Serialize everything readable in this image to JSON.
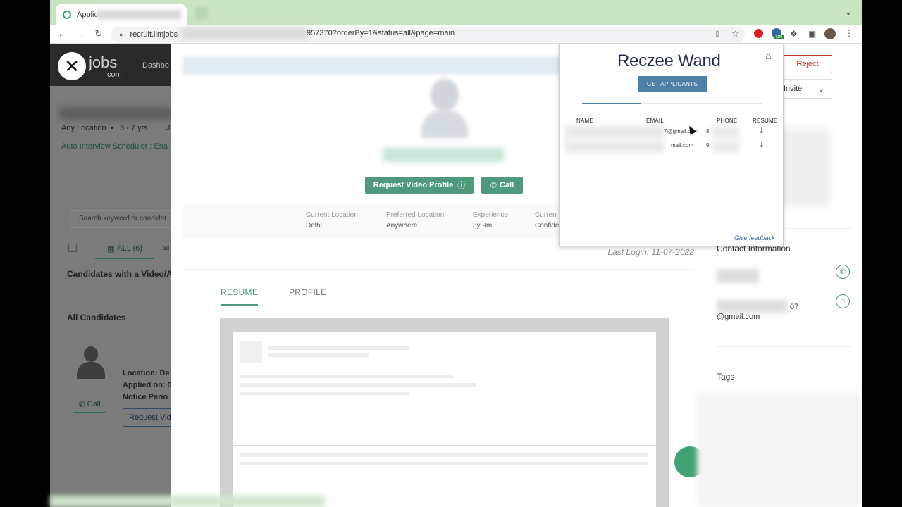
{
  "browser": {
    "tab_title": "Applic",
    "url_host": "recruit.iimjobs",
    "url_tail": "957370?orderBy=1&status=all&page=main",
    "extension_badge": "ON"
  },
  "site": {
    "logo": "jobs",
    "logo_sub": ".com",
    "nav_dashboard": "Dashbo"
  },
  "left_pane": {
    "location": "Any Location",
    "experience": "3 - 7 yrs",
    "experience_extra": "J",
    "auto_interview": "Auto Interview Scheduler : Ena",
    "search_placeholder": "Search keyword or candidat",
    "tab_all": "ALL (6)",
    "section_video": "Candidates with a Video/A",
    "section_all": "All Candidates",
    "candidate_location": "Location: De",
    "candidate_applied": "Applied on: 0",
    "candidate_notice": "Notice Perio",
    "call_label": "Call",
    "request_video_label": "Request Vid"
  },
  "modal": {
    "request_video_profile": "Request Video Profile",
    "call": "Call",
    "info": [
      {
        "label": "Current Location",
        "value": "Delhi"
      },
      {
        "label": "Preferred Location",
        "value": "Anywhere"
      },
      {
        "label": "Experience",
        "value": "3y 9m"
      },
      {
        "label": "Curren",
        "value": "Confide"
      }
    ],
    "last_login": "Last Login: 11-07-2022",
    "tab_resume": "RESUME",
    "tab_profile": "PROFILE"
  },
  "right_pane": {
    "reject": "Reject",
    "invite": "Invite",
    "contact_title": "Contact Information",
    "email_part1": "07",
    "email_part2": "@gmail.com",
    "tags_title": "Tags"
  },
  "extension": {
    "logo": "Reczee Wand",
    "get_applicants": "GET APPLICANTS",
    "progress": 0.33,
    "columns": {
      "name": "NAME",
      "email": "EMAIL",
      "phone": "PHONE",
      "resume": "RESUME"
    },
    "rows": [
      {
        "email": "7@gmail.com",
        "phone": "8"
      },
      {
        "email": "mail.com",
        "phone": "9"
      }
    ],
    "feedback": "Give feedback"
  }
}
